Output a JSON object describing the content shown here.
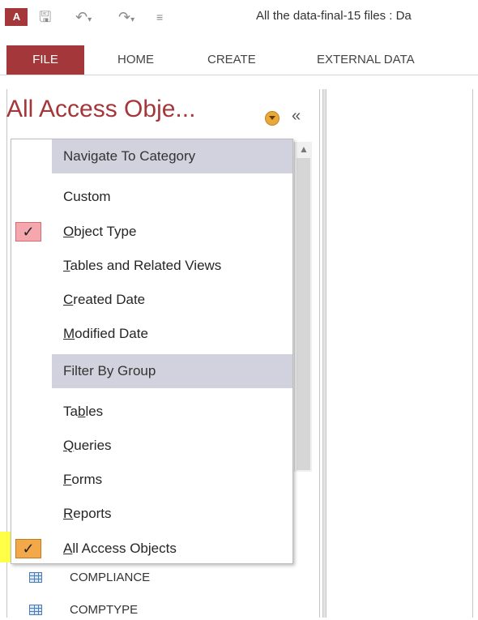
{
  "title_bar": {
    "app_logo": "A",
    "title": "All the data-final-15 files : Da",
    "icons": [
      "access-logo-icon",
      "save-icon",
      "undo-icon",
      "redo-icon",
      "customize-qat-icon"
    ]
  },
  "ribbon": {
    "tabs": [
      "FILE",
      "HOME",
      "CREATE",
      "EXTERNAL DATA"
    ]
  },
  "nav_pane": {
    "header": "All Access Obje...",
    "collapse_symbol": "«"
  },
  "menu": {
    "section1": "Navigate To Category",
    "nav_items": [
      {
        "pre": "",
        "u": "",
        "post": "Custom",
        "checked": false
      },
      {
        "pre": "",
        "u": "O",
        "post": "bject Type",
        "checked": true
      },
      {
        "pre": "",
        "u": "T",
        "post": "ables and Related Views",
        "checked": false
      },
      {
        "pre": "",
        "u": "C",
        "post": "reated Date",
        "checked": false
      },
      {
        "pre": "",
        "u": "M",
        "post": "odified Date",
        "checked": false
      }
    ],
    "section2": "Filter By Group",
    "filter_items": [
      {
        "pre": "Ta",
        "u": "b",
        "post": "les",
        "checked": false
      },
      {
        "pre": "",
        "u": "Q",
        "post": "ueries",
        "checked": false
      },
      {
        "pre": "",
        "u": "F",
        "post": "orms",
        "checked": false
      },
      {
        "pre": "",
        "u": "R",
        "post": "eports",
        "checked": false
      },
      {
        "pre": "",
        "u": "A",
        "post": "ll Access Objects",
        "checked": true
      }
    ],
    "check_mark": "✓"
  },
  "objects": [
    "COMPLIANCE",
    "COMPTYPE"
  ],
  "colors": {
    "accent": "#a4373a",
    "section_bg": "#d2d2de",
    "check_pink": "#f4a7ac",
    "check_orange": "#f3a84a",
    "highlight": "#ffff33"
  }
}
